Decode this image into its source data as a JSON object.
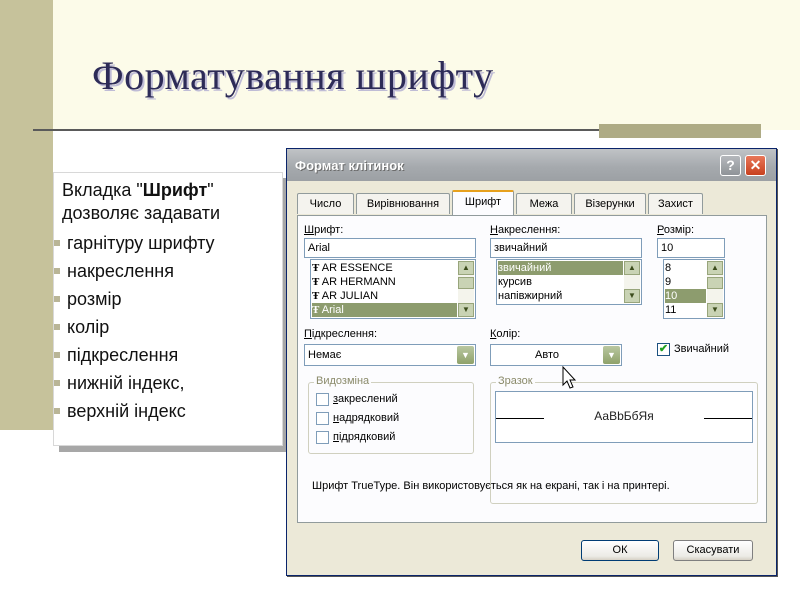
{
  "slide": {
    "title": "Форматування шрифту",
    "intro_prefix": "Вкладка \"",
    "intro_bold": "Шрифт",
    "intro_suffix": "\" дозволяє  задавати",
    "bullets": [
      "гарнітуру шрифту",
      "накреслення",
      "розмір",
      "колір",
      "підкреслення",
      "нижній індекс,",
      "верхній індекс"
    ]
  },
  "dialog": {
    "title": "Формат клітинок",
    "help_label": "?",
    "close_label": "✕",
    "tabs": [
      {
        "label": "Число",
        "active": false
      },
      {
        "label": "Вирівнювання",
        "active": false
      },
      {
        "label": "Шрифт",
        "active": true
      },
      {
        "label": "Межа",
        "active": false
      },
      {
        "label": "Візерунки",
        "active": false
      },
      {
        "label": "Захист",
        "active": false
      }
    ],
    "font": {
      "label_mnemonic": "Ш",
      "label_rest": "рифт:",
      "value": "Arial",
      "items": [
        "AR ESSENCE",
        "AR HERMANN",
        "AR JULIAN",
        "Arial"
      ],
      "selected": "Arial"
    },
    "style": {
      "label_mnemonic": "Н",
      "label_rest": "акреслення:",
      "value": "звичайний",
      "items": [
        "звичайний",
        "курсив",
        "напівжирний"
      ],
      "selected": "звичайний"
    },
    "size": {
      "label_mnemonic": "Р",
      "label_rest": "озмір:",
      "value": "10",
      "items": [
        "8",
        "9",
        "10",
        "11"
      ],
      "selected": "10"
    },
    "underline": {
      "label_mnemonic": "П",
      "label_rest": "ідкреслення:",
      "value": "Немає"
    },
    "color": {
      "label_mnemonic": "К",
      "label_rest": "олір:",
      "value": "Авто"
    },
    "normal_font": {
      "label": "Звичайний",
      "checked": true
    },
    "effects": {
      "group_label": "Видозміна",
      "strikethrough": {
        "mnemonic": "з",
        "rest": "акреслений",
        "checked": false
      },
      "superscript": {
        "mnemonic": "н",
        "rest": "адрядковий",
        "checked": false
      },
      "subscript": {
        "mnemonic": "п",
        "rest": "ідрядковий",
        "checked": false
      }
    },
    "preview": {
      "group_label": "Зразок",
      "text": "АаBbБбЯя"
    },
    "note": "Шрифт TrueType. Він використовується як на екрані, так і на принтері.",
    "ok_label": "ОК",
    "cancel_label": "Скасувати"
  },
  "colors": {
    "title": "#2d2b57",
    "selection": "#8d9c6e",
    "active_tab_accent": "#e7a11d",
    "sidebar": "#c6c29b"
  }
}
